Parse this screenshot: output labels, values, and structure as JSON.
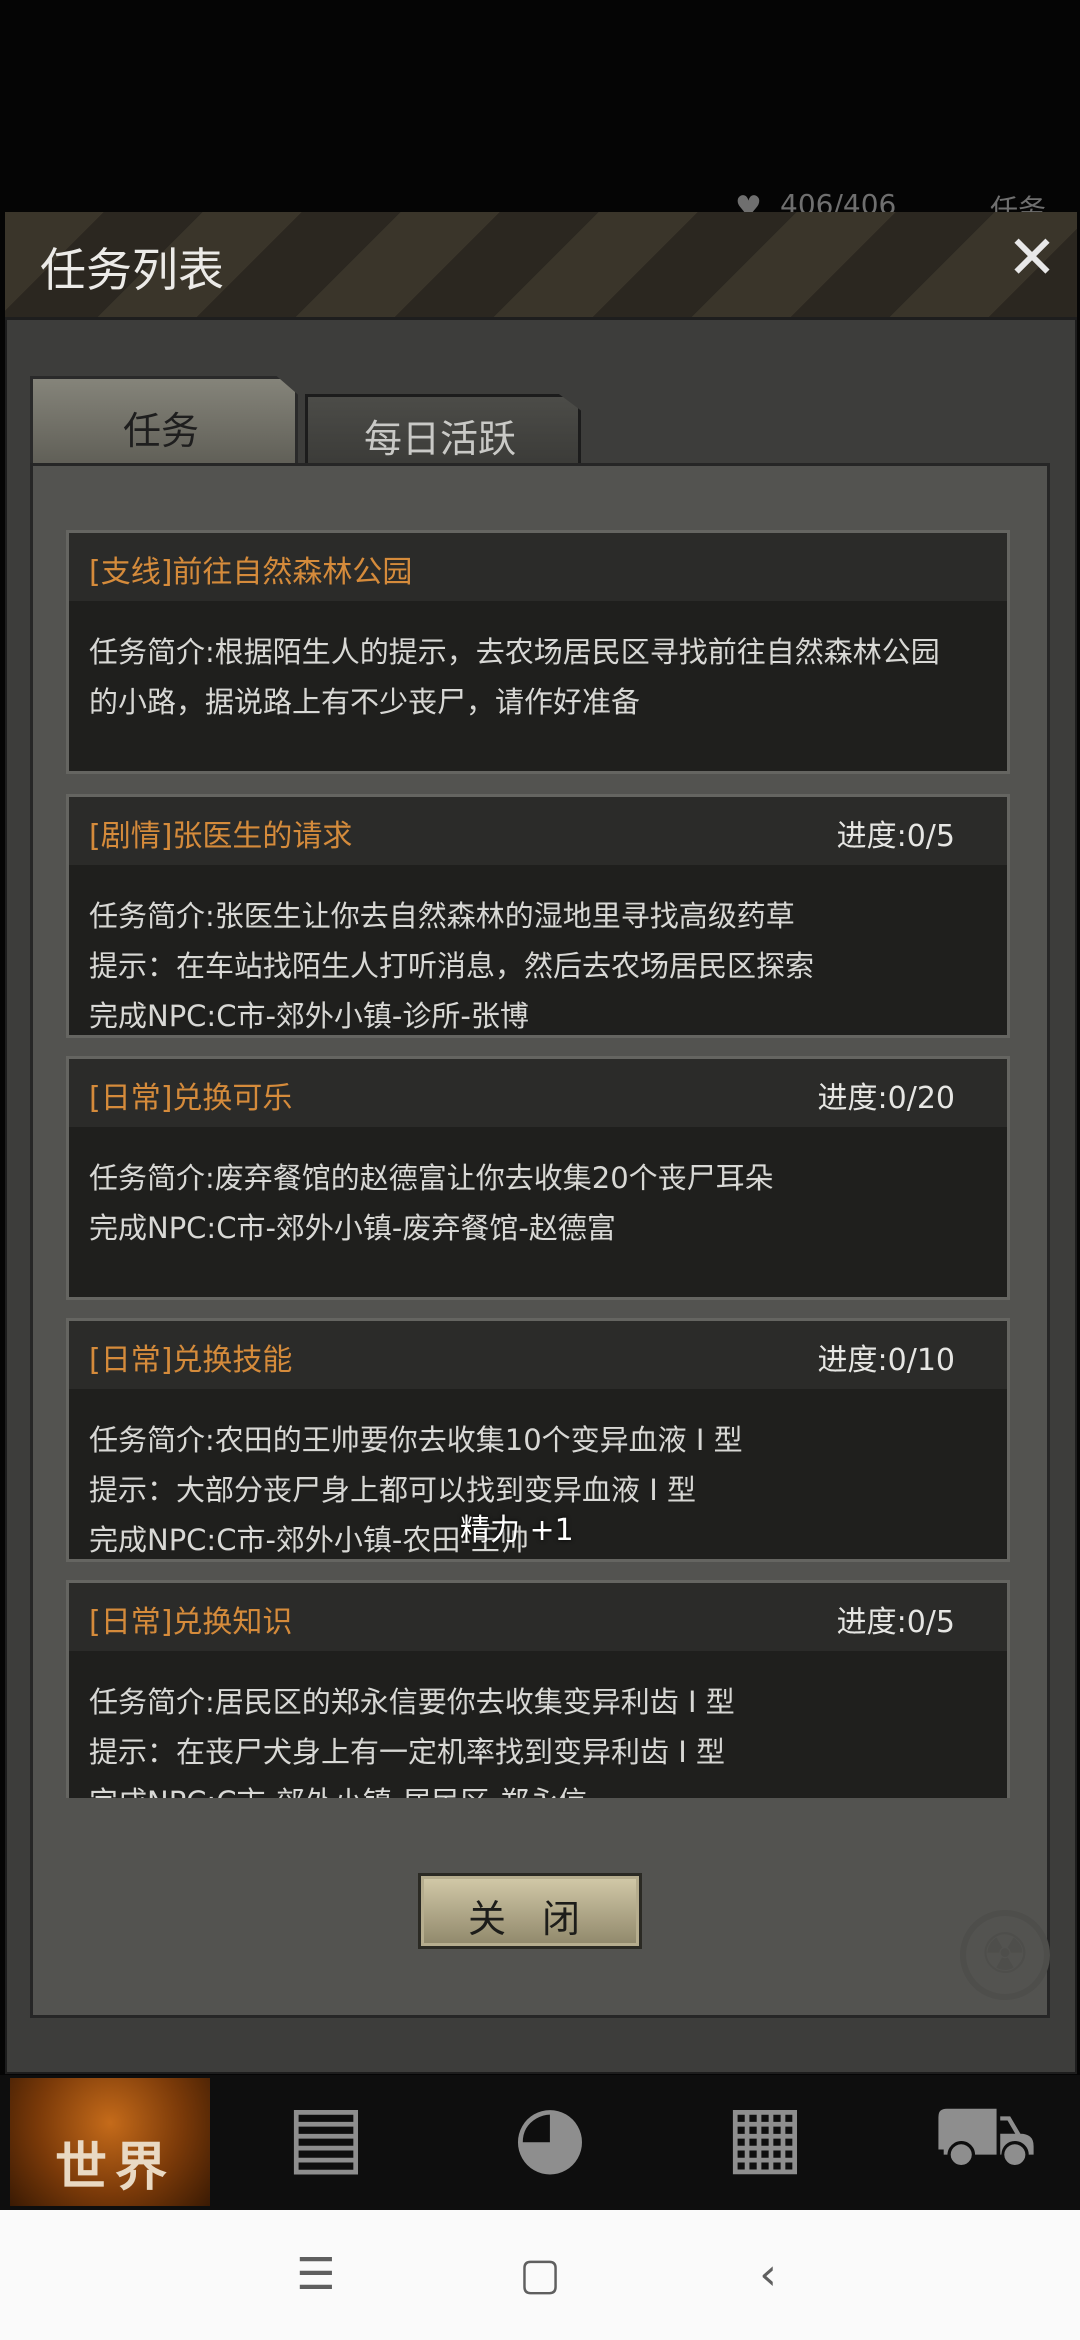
{
  "hud": {
    "heart_icon": "heart-icon",
    "hp_text": "406/406",
    "right_text": "任务"
  },
  "dialog": {
    "title": "任务列表",
    "close_icon": "close-x-icon",
    "tabs": [
      {
        "label": "任务",
        "active": true
      },
      {
        "label": "每日活跃",
        "active": false
      }
    ],
    "close_button_label": "关 闭"
  },
  "tasks": [
    {
      "title": "[支线]前往自然森林公园",
      "progress": "",
      "lines": [
        "任务简介:根据陌生人的提示，去农场居民区寻找前往自然森林公园",
        "的小路，据说路上有不少丧尸，请作好准备"
      ]
    },
    {
      "title": "[剧情]张医生的请求",
      "progress": "进度:0/5",
      "lines": [
        "任务简介:张医生让你去自然森林的湿地里寻找高级药草",
        "提示：在车站找陌生人打听消息，然后去农场居民区探索",
        "完成NPC:C市-郊外小镇-诊所-张博"
      ]
    },
    {
      "title": "[日常]兑换可乐",
      "progress": "进度:0/20",
      "lines": [
        "任务简介:废弃餐馆的赵德富让你去收集20个丧尸耳朵",
        "完成NPC:C市-郊外小镇-废弃餐馆-赵德富"
      ]
    },
    {
      "title": "[日常]兑换技能",
      "progress": "进度:0/10",
      "lines": [
        "任务简介:农田的王帅要你去收集10个变异血液 I 型",
        "提示：大部分丧尸身上都可以找到变异血液 I 型",
        "完成NPC:C市-郊外小镇-农田-王帅"
      ]
    },
    {
      "title": "[日常]兑换知识",
      "progress": "进度:0/5",
      "lines": [
        "任务简介:居民区的郑永信要你去收集变异利齿 I 型",
        "提示：在丧尸犬身上有一定机率找到变异利齿 I 型",
        "完成NPC:C市-郊外小镇-居民区-郑永信"
      ]
    }
  ],
  "floating_text": "精力 +1",
  "game_nav": {
    "world_label": "世界",
    "icons": [
      "backpack-icon",
      "head-skill-icon",
      "phone-icon",
      "cart-icon"
    ]
  },
  "system_nav": {
    "icons": [
      "menu-icon",
      "home-icon",
      "back-icon"
    ],
    "glyphs": [
      "☰",
      "▢",
      "‹"
    ]
  }
}
